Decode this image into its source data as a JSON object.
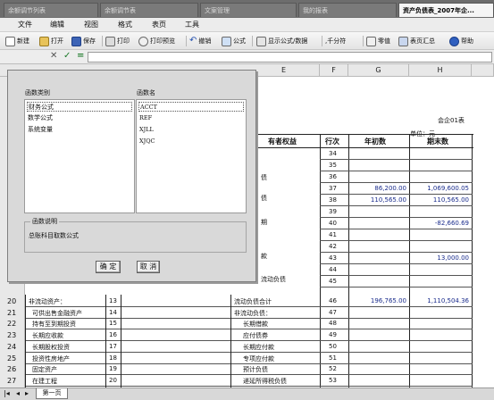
{
  "doc_tabs": [
    {
      "label": "余额调节列表",
      "active": false
    },
    {
      "label": "余额调节表",
      "active": false
    },
    {
      "label": "文案管理",
      "active": false
    },
    {
      "label": "我的报表",
      "active": false
    },
    {
      "label": "资产负债表_2007年企...",
      "active": true
    }
  ],
  "menu": [
    "文件",
    "编辑",
    "视图",
    "格式",
    "表页",
    "工具"
  ],
  "toolbar": {
    "new": "新建",
    "open": "打开",
    "save": "保存",
    "print": "打印",
    "preview": "打印预览",
    "undo": "撤销",
    "formula": "公式",
    "show_formula": "显示公式/数据",
    "thousands": ",千分符",
    "zero": "零值",
    "summary": "表页汇总",
    "help": "帮助"
  },
  "columns": [
    "E",
    "F",
    "G",
    "H"
  ],
  "report": {
    "form_no": "会企01表",
    "unit": "单位：元",
    "hdr_equity": "有者权益",
    "hdr_line": "行次",
    "hdr_begin": "年初数",
    "hdr_end": "期末数",
    "partial_text_1": "债",
    "partial_text_2": "债",
    "partial_text_3": "期",
    "partial_text_4": "款",
    "partial_text_5": "流动负债"
  },
  "upper_rows": [
    {
      "line": "34",
      "g": "",
      "h": ""
    },
    {
      "line": "35",
      "g": "",
      "h": ""
    },
    {
      "line": "36",
      "g": "",
      "h": ""
    },
    {
      "line": "37",
      "g": "86,200.00",
      "h": "1,069,600.05"
    },
    {
      "line": "38",
      "g": "110,565.00",
      "h": "110,565.00"
    },
    {
      "line": "39",
      "g": "",
      "h": ""
    },
    {
      "line": "40",
      "g": "",
      "h": "-82,660.69"
    },
    {
      "line": "41",
      "g": "",
      "h": ""
    },
    {
      "line": "42",
      "g": "",
      "h": ""
    },
    {
      "line": "43",
      "g": "",
      "h": "13,000.00"
    },
    {
      "line": "44",
      "g": "",
      "h": ""
    },
    {
      "line": "45",
      "g": "",
      "h": ""
    }
  ],
  "lower_rows": [
    {
      "row": "20",
      "a": "非流动资产：",
      "b": "13",
      "e": "流动负债合计",
      "f": "46",
      "g": "196,765.00",
      "h": "1,110,504.36"
    },
    {
      "row": "21",
      "a": "可供出售金融资产",
      "b": "14",
      "e": "非流动负债：",
      "f": "47",
      "g": "",
      "h": ""
    },
    {
      "row": "22",
      "a": "持有至到期投资",
      "b": "15",
      "e": "长期借款",
      "f": "48",
      "g": "",
      "h": ""
    },
    {
      "row": "23",
      "a": "长期应收款",
      "b": "16",
      "e": "应付债券",
      "f": "49",
      "g": "",
      "h": ""
    },
    {
      "row": "24",
      "a": "长期股权投资",
      "b": "17",
      "e": "长期应付款",
      "f": "50",
      "g": "",
      "h": ""
    },
    {
      "row": "25",
      "a": "投资性房地产",
      "b": "18",
      "e": "专项应付款",
      "f": "51",
      "g": "",
      "h": ""
    },
    {
      "row": "26",
      "a": "固定资产",
      "b": "19",
      "e": "预计负债",
      "f": "52",
      "g": "",
      "h": ""
    },
    {
      "row": "27",
      "a": "在建工程",
      "b": "20",
      "e": "递延所得税负债",
      "f": "53",
      "g": "",
      "h": ""
    }
  ],
  "sheet_tab": "第一页",
  "dialog": {
    "category_label": "函数类别",
    "name_label": "函数名",
    "categories": [
      "财务公式",
      "数学公式",
      "系统变量"
    ],
    "functions": [
      "ACCT",
      "REF",
      "XJLL",
      "XJQC"
    ],
    "desc_legend": "函数说明",
    "desc_text": "总账科目取数公式",
    "ok": "确 定",
    "cancel": "取 消"
  }
}
